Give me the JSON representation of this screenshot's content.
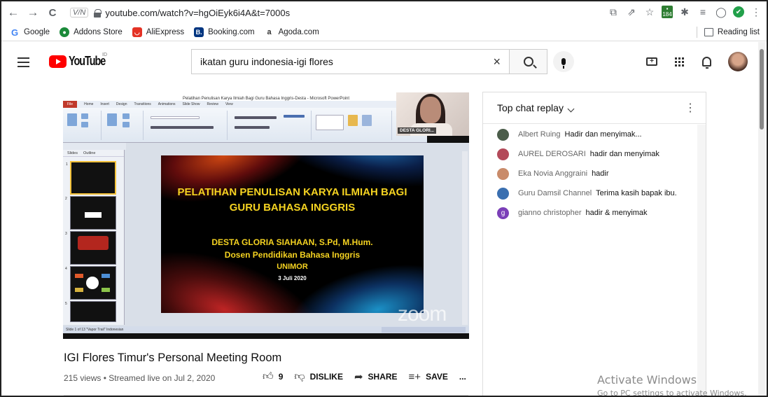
{
  "browser": {
    "back": "←",
    "forward": "→",
    "reload": "C",
    "site_badge": "V/N",
    "url": "youtube.com/watch?v=hgOiEyk6i4A&t=7000s",
    "extension_badge": "184",
    "bookmarks": [
      {
        "label": "Google",
        "color": "#4285f4"
      },
      {
        "label": "Addons Store",
        "color": "#1b8a3a"
      },
      {
        "label": "AliExpress",
        "color": "#e43225"
      },
      {
        "label": "Booking.com",
        "color": "#003580"
      },
      {
        "label": "Agoda.com",
        "color": "#ffffff"
      }
    ],
    "reading_list": "Reading list"
  },
  "youtube": {
    "logo_text": "YouTube",
    "country_code": "ID",
    "search_value": "ikatan guru indonesia-igi flores",
    "clear": "×"
  },
  "video": {
    "ppt_window_title": "Pelatihan Penulisan Karya Ilmiah Bagi Guru Bahasa Inggris-Desta - Microsoft PowerPoint",
    "ribbon_tabs": [
      "File",
      "Home",
      "Insert",
      "Design",
      "Transitions",
      "Animations",
      "Slide Show",
      "Review",
      "View"
    ],
    "thumb_tabs": [
      "Slides",
      "Outline"
    ],
    "thumb_numbers": [
      "1",
      "2",
      "3",
      "4",
      "5"
    ],
    "speaker_name": "DESTA GLORI...",
    "slide": {
      "title_line1": "PELATIHAN PENULISAN KARYA ILMIAH BAGI",
      "title_line2": "GURU BAHASA INGGRIS",
      "author": "DESTA GLORIA SIAHAAN, S.Pd, M.Hum.",
      "role": "Dosen Pendidikan Bahasa Inggris",
      "institution": "UNIMOR",
      "date": "3 Juli 2020"
    },
    "status_bar": "Slide 1 of 13   \"Vapor Trail\"   Indonesian",
    "zoom_watermark": "zoom"
  },
  "info": {
    "title": "IGI Flores Timur's Personal Meeting Room",
    "meta": "215 views • Streamed live on Jul 2, 2020",
    "likes": "9",
    "dislike": "DISLIKE",
    "share": "SHARE",
    "save": "SAVE",
    "more": "..."
  },
  "chat": {
    "header": "Top chat replay",
    "more": "⋮",
    "messages": [
      {
        "author": "Albert Ruing",
        "text": "Hadir dan menyimak...",
        "avatar_color": "#4b5d4a"
      },
      {
        "author": "AUREL DEROSARI",
        "text": "hadir dan menyimak",
        "avatar_color": "#b34a5a"
      },
      {
        "author": "Eka Novia Anggraini",
        "text": "hadir",
        "avatar_color": "#c98b6a"
      },
      {
        "author": "Guru Damsil Channel",
        "text": "Terima kasih bapak ibu.",
        "avatar_color": "#3a6fb0"
      },
      {
        "author": "gianno christopher",
        "text": "hadir & menyimak",
        "avatar_color": "#7b3fb8",
        "initial": "g"
      }
    ]
  },
  "os": {
    "activate_title": "Activate Windows",
    "activate_sub": "Go to PC settings to activate Windows."
  }
}
